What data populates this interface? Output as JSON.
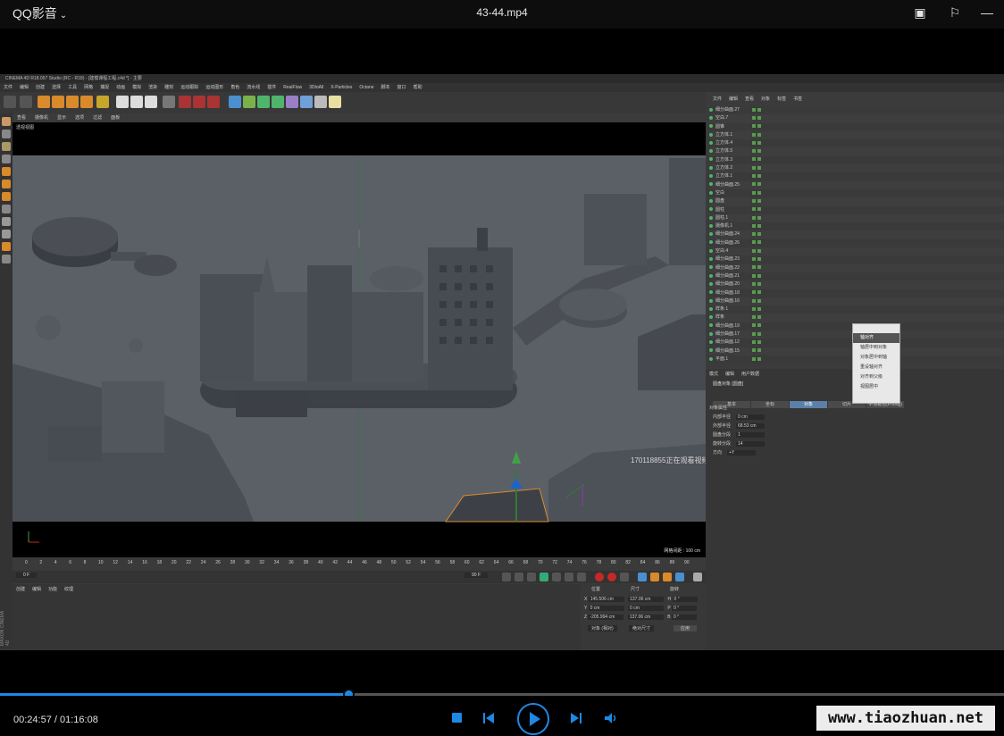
{
  "player": {
    "app_title": "QQ影音",
    "file_title": "43-44.mp4",
    "current_time": "00:24:57",
    "separator": " / ",
    "total_time": "01:16:08",
    "progress": 0.347
  },
  "c4d": {
    "window_title": "CINEMA 4D R18.057 Studio (RC - R18) - [建模课程工程.c4d *] - 主要",
    "menu": [
      "文件",
      "编辑",
      "创建",
      "选择",
      "工具",
      "网格",
      "捕捉",
      "动画",
      "模拟",
      "渲染",
      "雕刻",
      "运动跟踪",
      "运动图形",
      "角色",
      "流水线",
      "插件",
      "RealFlow",
      "3DtoAll",
      "X-Particles",
      "Octane",
      "脚本",
      "窗口",
      "帮助"
    ],
    "viewport_menu": [
      "查看",
      "摄像机",
      "显示",
      "选项",
      "过滤",
      "面板"
    ],
    "viewport_label": "透视视图",
    "grid_spacing": "网格间距 : 100 cm",
    "overlay_text": "170118855正在观看视频",
    "ruler": [
      "0",
      "2",
      "4",
      "6",
      "8",
      "10",
      "12",
      "14",
      "16",
      "18",
      "20",
      "22",
      "24",
      "26",
      "28",
      "30",
      "32",
      "34",
      "36",
      "38",
      "40",
      "42",
      "44",
      "46",
      "48",
      "50",
      "52",
      "54",
      "56",
      "58",
      "60",
      "62",
      "64",
      "66",
      "68",
      "70",
      "72",
      "74",
      "76",
      "78",
      "80",
      "82",
      "84",
      "86",
      "88",
      "90"
    ],
    "frame_start": "0 F",
    "frame_end": "90 F",
    "frame_current": "0 F",
    "material_menu": [
      "创建",
      "编辑",
      "功能",
      "纹理"
    ],
    "coords": {
      "headers": [
        "位置",
        "尺寸",
        "旋转"
      ],
      "rows": [
        {
          "axis": "X",
          "pos": "145.506 cm",
          "size": "137.06 cm",
          "rot_axis": "H",
          "rot": "0 °"
        },
        {
          "axis": "Y",
          "pos": "0 cm",
          "size": "0 cm",
          "rot_axis": "P",
          "rot": "0 °"
        },
        {
          "axis": "Z",
          "pos": "-205.994 cm",
          "size": "137.06 cm",
          "rot_axis": "B",
          "rot": "0 °"
        }
      ],
      "mode": "对象 (相对)",
      "size_mode": "绝对尺寸",
      "apply": "应用"
    },
    "object_manager": {
      "menu": [
        "文件",
        "编辑",
        "查看",
        "对象",
        "标签",
        "书签"
      ],
      "items": [
        "细分曲面.27",
        "空白.7",
        "圆锥",
        "立方体.1",
        "立方体.4",
        "立方体.5",
        "立方体.3",
        "立方体.2",
        "立方体.1",
        "细分曲面.25",
        "空白",
        "圆盘",
        "圆柱",
        "圆柱.1",
        "摄像机.1",
        "细分曲面.24",
        "细分曲面.26",
        "空白.4",
        "细分曲面.23",
        "细分曲面.22",
        "细分曲面.21",
        "细分曲面.20",
        "细分曲面.18",
        "细分曲面.16",
        "样条.1",
        "样条",
        "细分曲面.19",
        "细分曲面.17",
        "细分曲面.12",
        "细分曲面.15",
        "平面.1"
      ]
    },
    "context_menu": [
      "轴对齐",
      "轴居中到对象",
      "对象居中到轴",
      "重设轴对齐",
      "对齐到父级",
      "视图居中"
    ],
    "attributes": {
      "menu": [
        "模式",
        "编辑",
        "用户数据"
      ],
      "object_name": "圆盘对象 [圆盘]",
      "tabs": [
        "基本",
        "坐标",
        "对象",
        "切片",
        "平滑着色(Phong)"
      ],
      "active_tab": 2,
      "section": "对象属性",
      "fields": [
        {
          "label": "内部半径",
          "value": "0 cm"
        },
        {
          "label": "外部半径",
          "value": "68.53 cm"
        },
        {
          "label": "圆盘分段",
          "value": "1"
        },
        {
          "label": "旋转分段",
          "value": "14"
        },
        {
          "label": "方向",
          "value": "+Y"
        }
      ]
    },
    "side_label": "MAXON CINEMA 4D"
  },
  "brand": "www.tiaozhuan.net",
  "colors": {
    "accent": "#1e88e5",
    "viewport_bg": "#5a5f66"
  }
}
